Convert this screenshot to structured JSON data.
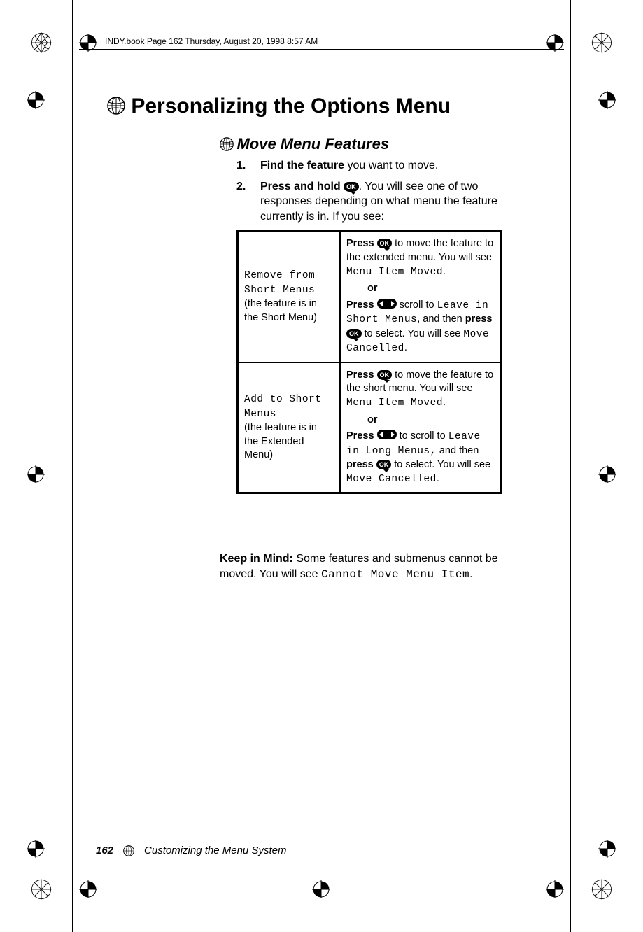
{
  "header": {
    "running_head": "INDY.book  Page 162  Thursday, August 20, 1998  8:57 AM"
  },
  "h1": "Personalizing the Options Menu",
  "h2": "Move Menu Features",
  "steps": [
    {
      "num": "1.",
      "bold": "Find the feature",
      "rest": " you want to move."
    },
    {
      "num": "2.",
      "bold": "Press and hold ",
      "after_icon": ". You will see one of two responses depending on what menu the feature currently is in. If you see:"
    }
  ],
  "icons": {
    "ok": "OK"
  },
  "table": {
    "rows": [
      {
        "left_lcd": "Remove from Short Menus",
        "left_note": "(the feature is in the Short Menu)",
        "r1_a": "Press ",
        "r1_b": " to move the feature to the extended menu. You will see ",
        "r1_lcd": "Menu Item Moved",
        "r1_c": ".",
        "or": "or",
        "r2_a": "Press ",
        "r2_b": " scroll to ",
        "r2_lcd1": "Leave in Short Menus",
        "r2_c": ", and then ",
        "r2_d": "press ",
        "r2_e": " to select. You will see ",
        "r2_lcd2": "Move Cancelled",
        "r2_f": "."
      },
      {
        "left_lcd": "Add to Short Menus",
        "left_note": "(the feature is in the Extended Menu)",
        "r1_a": "Press ",
        "r1_b": " to move the feature to the short menu. You will see ",
        "r1_lcd": "Menu Item Moved",
        "r1_c": ".",
        "or": "or",
        "r2_a": "Press ",
        "r2_b": " to scroll to ",
        "r2_lcd1": "Leave in Long Menus,",
        "r2_c": " and then ",
        "r2_d": "press ",
        "r2_e": " to select. You will see ",
        "r2_lcd2": "Move Cancelled",
        "r2_f": "."
      }
    ]
  },
  "keep": {
    "lead": "Keep in Mind:",
    "text_a": " Some features and submenus cannot be moved. You will see ",
    "lcd": "Cannot Move Menu Item",
    "text_b": "."
  },
  "footer": {
    "page": "162",
    "chapter": "Customizing the Menu System"
  }
}
